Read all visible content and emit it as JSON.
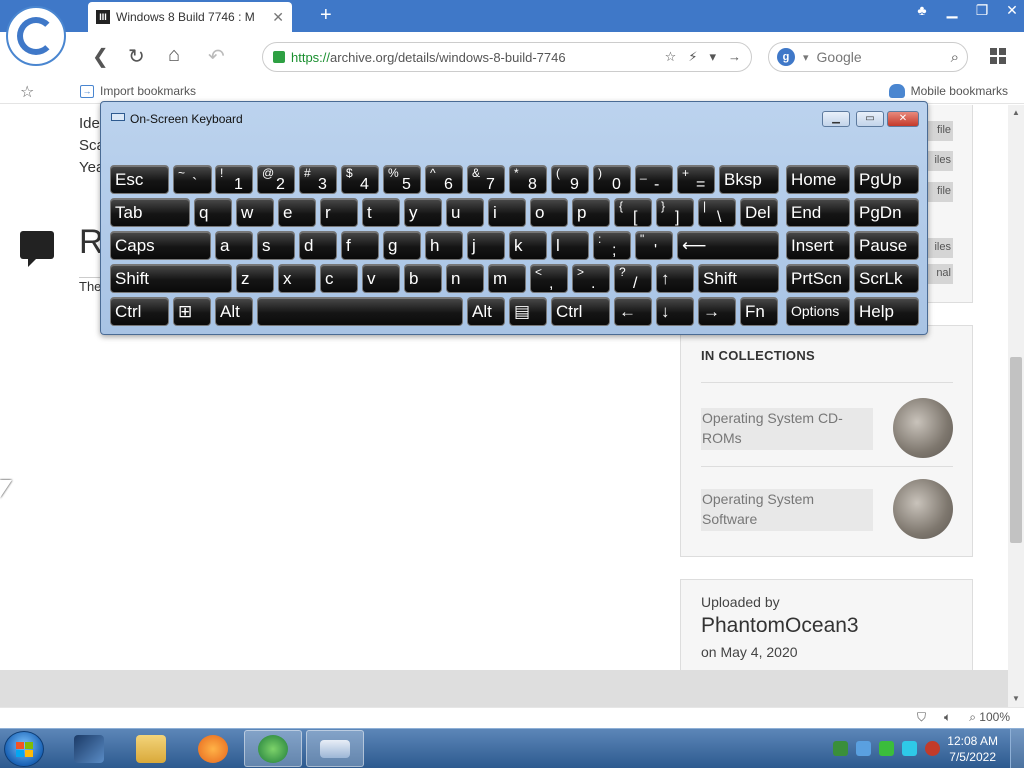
{
  "browser": {
    "tab_title": "Windows 8 Build 7746 : M",
    "tab_favicon": "III",
    "new_tab": "+",
    "url_scheme": "https://",
    "url_rest": "archive.org/details/windows-8-build-7746",
    "search_engine_letter": "g",
    "search_placeholder": "Google",
    "bookmarks": {
      "import": "Import bookmarks",
      "mobile": "Mobile bookmarks"
    },
    "zoom": "100%",
    "accent": "#3f78c8"
  },
  "page": {
    "meta_lines": [
      "Ide",
      "Sca",
      "Yea"
    ],
    "reviews_heading": "R",
    "reviews_sub": "The",
    "file_tags": [
      "file",
      "iles",
      "file",
      "iles",
      "nal"
    ],
    "collections": {
      "title": "IN COLLECTIONS",
      "items": [
        {
          "label": "Operating System CD-ROMs"
        },
        {
          "label": "Operating System Software"
        }
      ]
    },
    "uploader": {
      "label": "Uploaded by",
      "name": "PhantomOcean3",
      "date": "on May 4, 2020"
    }
  },
  "osk": {
    "title": "On-Screen Keyboard",
    "rows": [
      [
        {
          "label": "Esc"
        },
        {
          "top": "~",
          "bot": "`"
        },
        {
          "top": "!",
          "bot": "1"
        },
        {
          "top": "@",
          "bot": "2"
        },
        {
          "top": "#",
          "bot": "3"
        },
        {
          "top": "$",
          "bot": "4"
        },
        {
          "top": "%",
          "bot": "5"
        },
        {
          "top": "^",
          "bot": "6"
        },
        {
          "top": "&",
          "bot": "7"
        },
        {
          "top": "*",
          "bot": "8"
        },
        {
          "top": "(",
          "bot": "9"
        },
        {
          "top": ")",
          "bot": "0"
        },
        {
          "top": "_",
          "bot": "-"
        },
        {
          "top": "+",
          "bot": "="
        },
        {
          "label": "Bksp"
        },
        {
          "label": "Home"
        },
        {
          "label": "PgUp"
        }
      ],
      [
        {
          "label": "Tab"
        },
        {
          "label": "q"
        },
        {
          "label": "w"
        },
        {
          "label": "e"
        },
        {
          "label": "r"
        },
        {
          "label": "t"
        },
        {
          "label": "y"
        },
        {
          "label": "u"
        },
        {
          "label": "i"
        },
        {
          "label": "o"
        },
        {
          "label": "p"
        },
        {
          "top": "{",
          "bot": "["
        },
        {
          "top": "}",
          "bot": "]"
        },
        {
          "top": "|",
          "bot": "\\"
        },
        {
          "label": "Del"
        },
        {
          "label": "End"
        },
        {
          "label": "PgDn"
        }
      ],
      [
        {
          "label": "Caps"
        },
        {
          "label": "a"
        },
        {
          "label": "s"
        },
        {
          "label": "d"
        },
        {
          "label": "f"
        },
        {
          "label": "g"
        },
        {
          "label": "h"
        },
        {
          "label": "j"
        },
        {
          "label": "k"
        },
        {
          "label": "l"
        },
        {
          "top": ":",
          "bot": ";"
        },
        {
          "top": "\"",
          "bot": "'"
        },
        {
          "label": "⟵"
        },
        {
          "label": "Insert"
        },
        {
          "label": "Pause"
        }
      ],
      [
        {
          "label": "Shift"
        },
        {
          "label": "z"
        },
        {
          "label": "x"
        },
        {
          "label": "c"
        },
        {
          "label": "v"
        },
        {
          "label": "b"
        },
        {
          "label": "n"
        },
        {
          "label": "m"
        },
        {
          "top": "<",
          "bot": ","
        },
        {
          "top": ">",
          "bot": "."
        },
        {
          "top": "?",
          "bot": "/"
        },
        {
          "label": "↑"
        },
        {
          "label": "Shift"
        },
        {
          "label": "PrtScn"
        },
        {
          "label": "ScrLk"
        }
      ],
      [
        {
          "label": "Ctrl"
        },
        {
          "label": "⊞"
        },
        {
          "label": "Alt"
        },
        {
          "label": ""
        },
        {
          "label": "Alt"
        },
        {
          "label": "▤"
        },
        {
          "label": "Ctrl"
        },
        {
          "label": "←"
        },
        {
          "label": "↓"
        },
        {
          "label": "→"
        },
        {
          "label": "Fn"
        },
        {
          "label": "Options"
        },
        {
          "label": "Help"
        }
      ]
    ]
  },
  "taskbar": {
    "time": "12:08 AM",
    "date": "7/5/2022"
  }
}
